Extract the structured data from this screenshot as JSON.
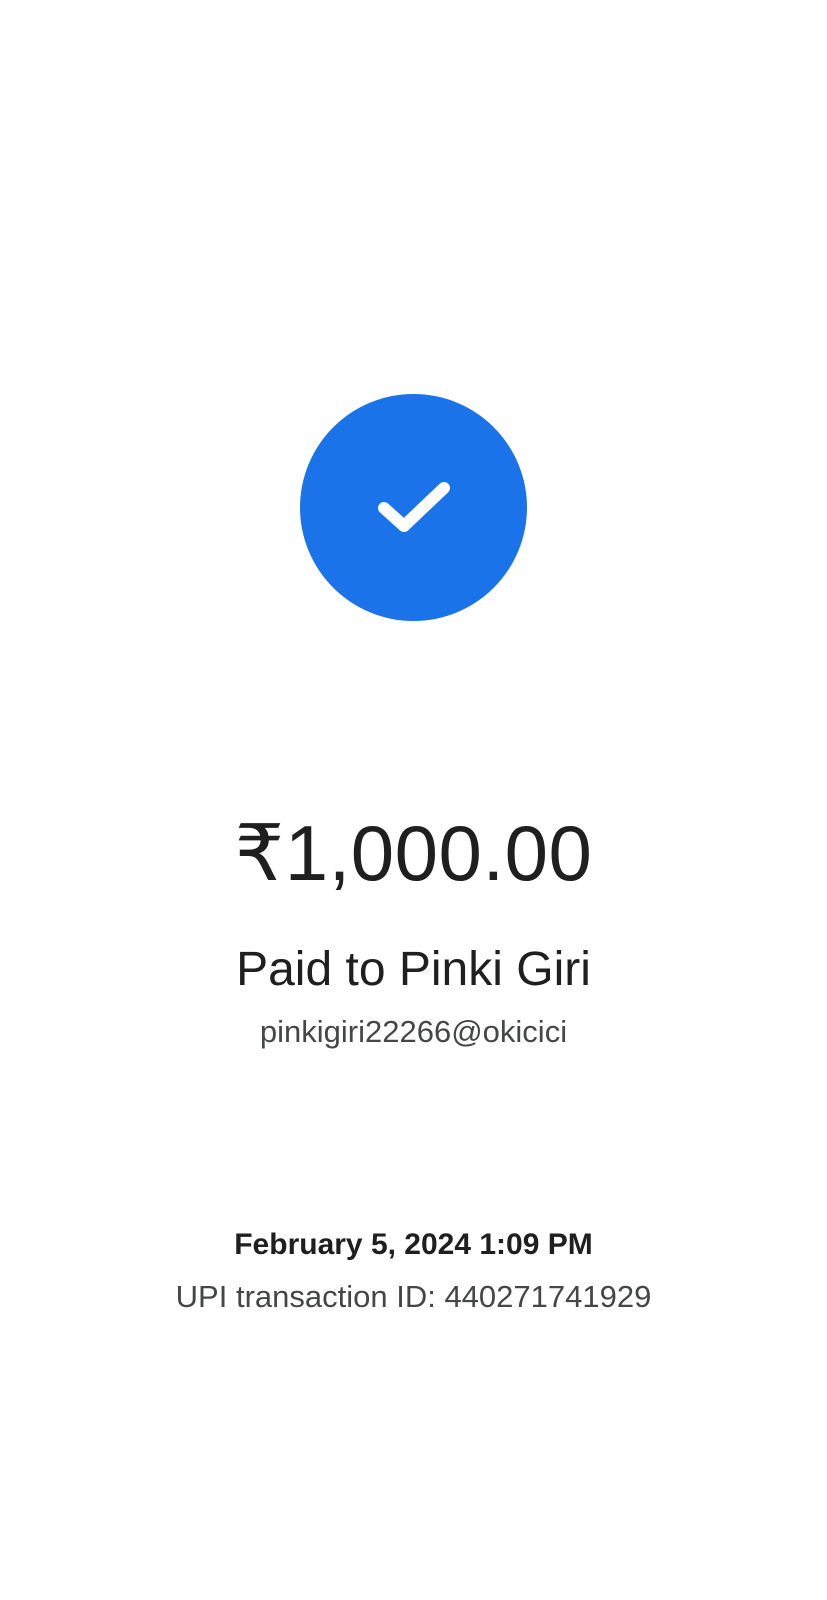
{
  "colors": {
    "accent": "#1a73e8",
    "check": "#ffffff",
    "primary_text": "#1f1f1f",
    "secondary_text": "#444746"
  },
  "icons": {
    "success": "check-circle-icon"
  },
  "payment": {
    "amount": "₹1,000.00",
    "paid_to_label": "Paid to Pinki Giri",
    "payee_upi_id": "pinkigiri22266@okicici",
    "datetime": "February 5, 2024 1:09 PM",
    "transaction_id": "UPI transaction ID: 440271741929"
  }
}
